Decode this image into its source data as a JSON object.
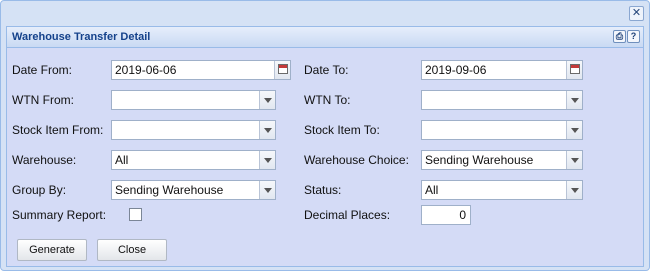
{
  "window": {
    "close_symbol": "✕"
  },
  "panel": {
    "title": "Warehouse Transfer Detail",
    "print_icon_glyph": "⎙",
    "help_icon_glyph": "?"
  },
  "form": {
    "date_from": {
      "label": "Date From:",
      "value": "2019-06-06"
    },
    "date_to": {
      "label": "Date To:",
      "value": "2019-09-06"
    },
    "wtn_from": {
      "label": "WTN From:",
      "value": ""
    },
    "wtn_to": {
      "label": "WTN To:",
      "value": ""
    },
    "stock_item_from": {
      "label": "Stock Item From:",
      "value": ""
    },
    "stock_item_to": {
      "label": "Stock Item To:",
      "value": ""
    },
    "warehouse": {
      "label": "Warehouse:",
      "value": "All"
    },
    "warehouse_choice": {
      "label": "Warehouse Choice:",
      "value": "Sending Warehouse"
    },
    "group_by": {
      "label": "Group By:",
      "value": "Sending Warehouse"
    },
    "status": {
      "label": "Status:",
      "value": "All"
    },
    "summary_report": {
      "label": "Summary Report:",
      "checked": false
    },
    "decimal_places": {
      "label": "Decimal Places:",
      "value": "0"
    }
  },
  "buttons": {
    "generate": "Generate",
    "close": "Close"
  },
  "icons": {
    "close": "close-icon",
    "print": "print-icon",
    "help": "help-icon",
    "calendar": "calendar-icon",
    "dropdown": "chevron-down-icon"
  }
}
